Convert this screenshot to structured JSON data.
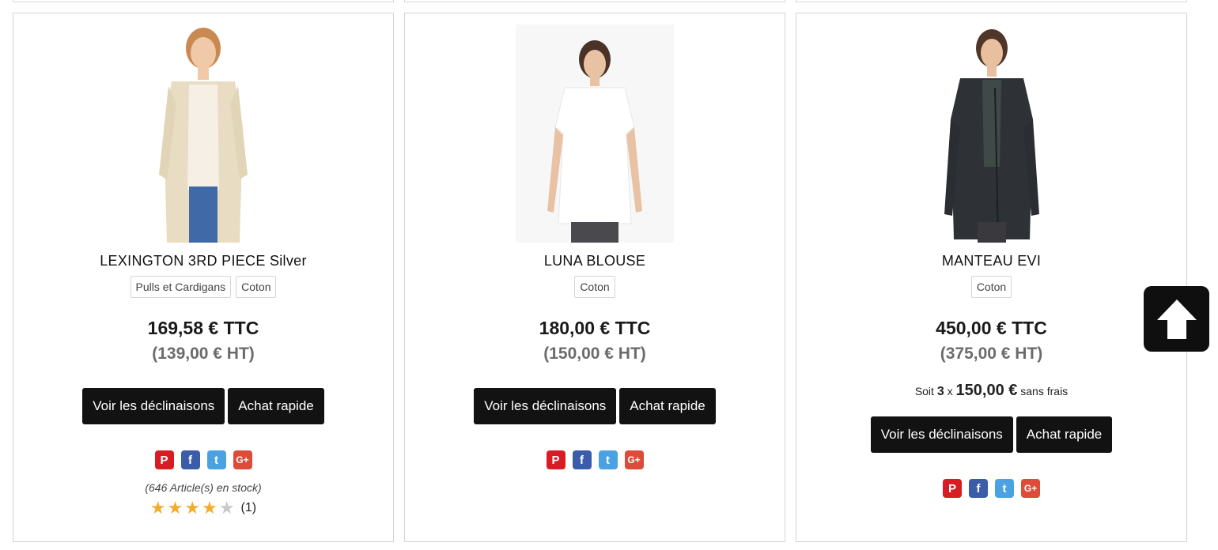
{
  "products": [
    {
      "title": "LEXINGTON 3RD PIECE Silver",
      "tags": [
        "Pulls et Cardigans",
        "Coton"
      ],
      "price_ttc": "169,58 € TTC",
      "price_ht": "(139,00 € HT)",
      "variants_label": "Voir les déclinaisons",
      "quick_buy_label": "Achat rapide",
      "stock": "(646 Article(s) en stock)",
      "rating": 4,
      "rating_max": 5,
      "reviews": "(1)"
    },
    {
      "title": "LUNA BLOUSE",
      "tags": [
        "Coton"
      ],
      "price_ttc": "180,00 € TTC",
      "price_ht": "(150,00 € HT)",
      "variants_label": "Voir les déclinaisons",
      "quick_buy_label": "Achat rapide"
    },
    {
      "title": "MANTEAU EVI",
      "tags": [
        "Coton"
      ],
      "price_ttc": "450,00 € TTC",
      "price_ht": "(375,00 € HT)",
      "installment": {
        "prefix": "Soit",
        "count": "3",
        "times": "x",
        "amount": "150,00 €",
        "suffix": "sans frais"
      },
      "variants_label": "Voir les déclinaisons",
      "quick_buy_label": "Achat rapide"
    }
  ],
  "social_icons": [
    "pinterest-icon",
    "facebook-icon",
    "twitter-icon",
    "google-plus-icon"
  ],
  "social_glyphs": {
    "pinterest": "P",
    "facebook": "f",
    "twitter": "t",
    "googleplus": "G+"
  },
  "colors": {
    "button_bg": "#121212",
    "star": "#f3ad2b",
    "pinterest": "#d91c24",
    "facebook": "#3b5ca8",
    "twitter": "#4aa2e3",
    "googleplus": "#dd4b39"
  }
}
